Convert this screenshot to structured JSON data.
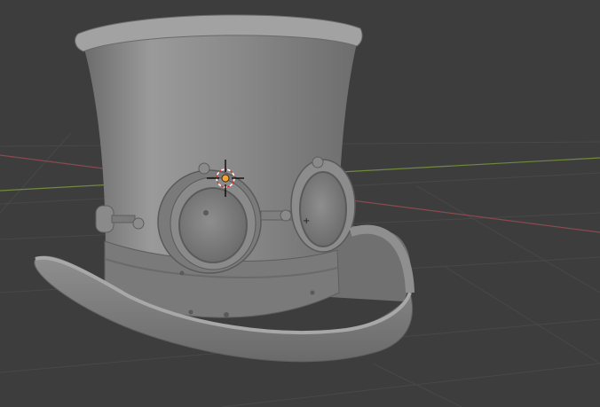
{
  "viewport": {
    "background": "#3d3d3d",
    "grid_color": "#484848",
    "x_axis_color": "#8a4a4f",
    "y_axis_color": "#6f8a3e",
    "model": {
      "name": "steampunk-top-hat",
      "shading": "matcap-grey",
      "base_color": "#8a8a8a",
      "shadow_color": "#5b5b5b",
      "highlight_color": "#b3b3b3"
    },
    "cursor": {
      "icon": "3d-cursor-icon",
      "ring_color_a": "#ffffff",
      "ring_color_b": "#d23a3a",
      "origin_color": "#f2a23a"
    }
  }
}
